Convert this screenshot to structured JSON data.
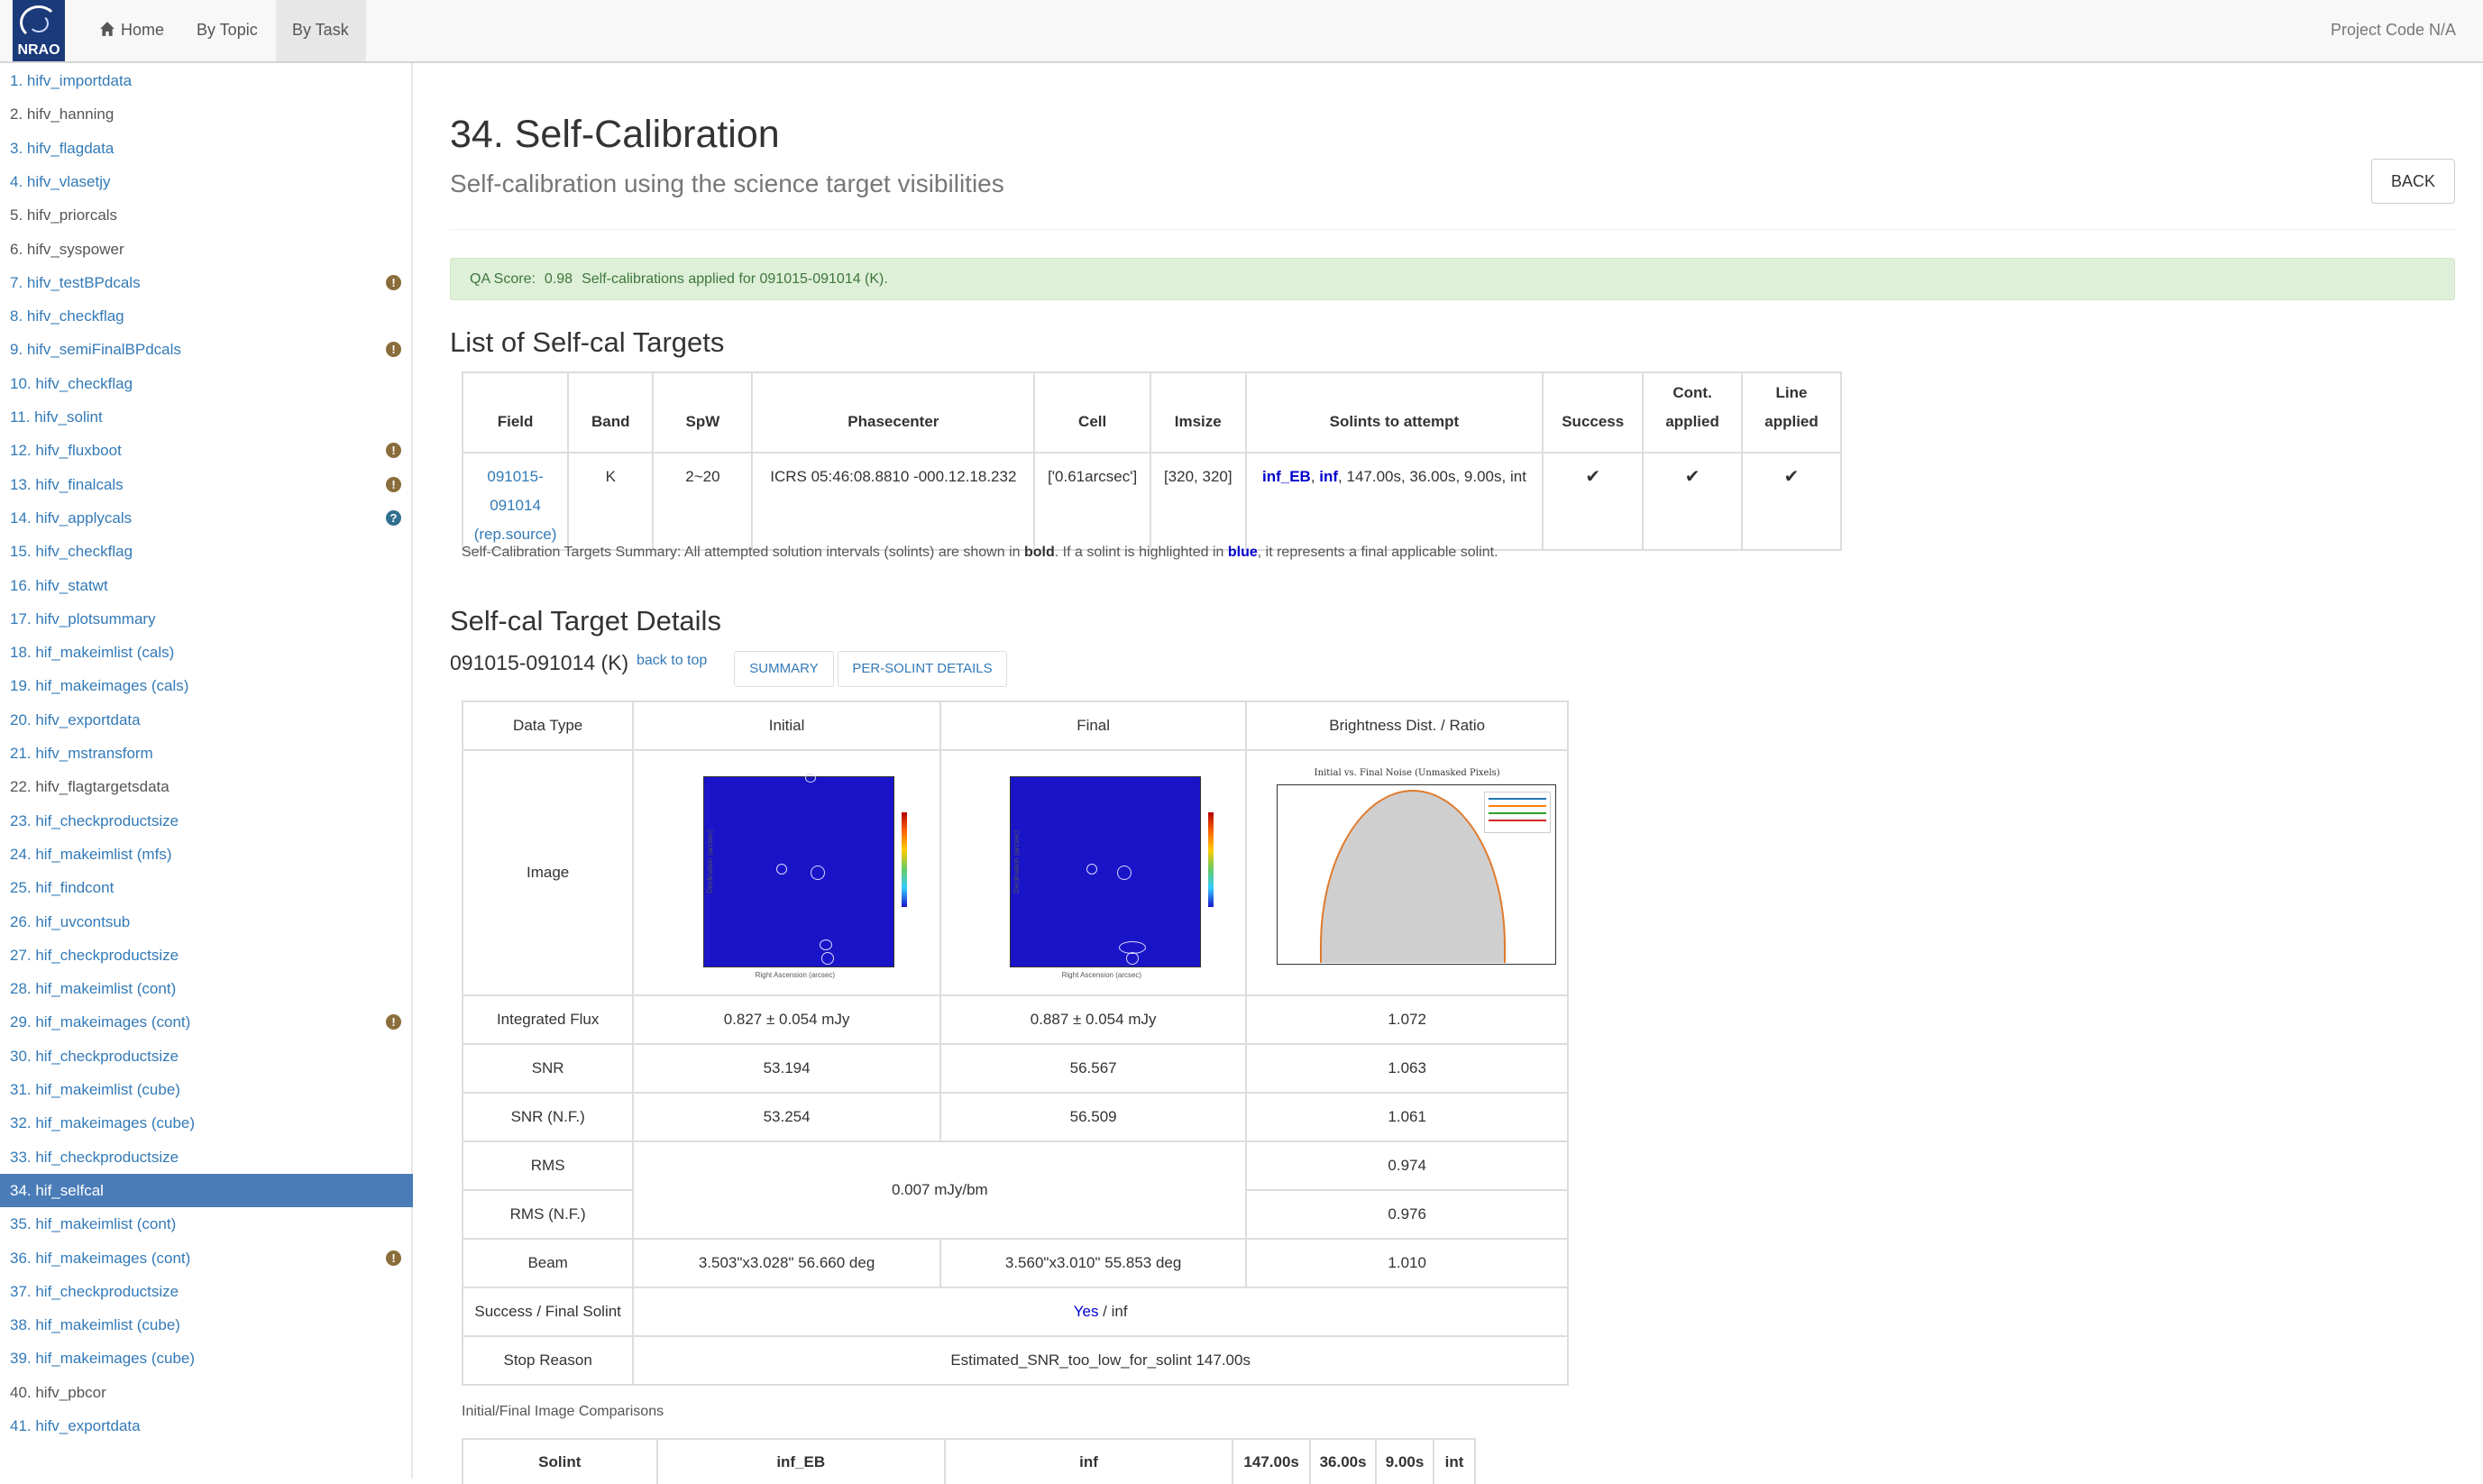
{
  "navbar": {
    "logo_text": "NRAO",
    "home_label": "Home",
    "topic_label": "By Topic",
    "task_label": "By Task",
    "project_code": "Project Code N/A"
  },
  "sidebar": {
    "items": [
      {
        "label": "1. hifv_importdata"
      },
      {
        "label": "2. hifv_hanning"
      },
      {
        "label": "3. hifv_flagdata"
      },
      {
        "label": "4. hifv_vlasetjy"
      },
      {
        "label": "5. hifv_priorcals"
      },
      {
        "label": "6. hifv_syspower"
      },
      {
        "label": "7. hifv_testBPdcals",
        "badge": "!"
      },
      {
        "label": "8. hifv_checkflag"
      },
      {
        "label": "9. hifv_semiFinalBPdcals",
        "badge": "!"
      },
      {
        "label": "10. hifv_checkflag"
      },
      {
        "label": "11. hifv_solint"
      },
      {
        "label": "12. hifv_fluxboot",
        "badge": "!"
      },
      {
        "label": "13. hifv_finalcals",
        "badge": "!"
      },
      {
        "label": "14. hifv_applycals",
        "badge": "?"
      },
      {
        "label": "15. hifv_checkflag"
      },
      {
        "label": "16. hifv_statwt"
      },
      {
        "label": "17. hifv_plotsummary"
      },
      {
        "label": "18. hif_makeimlist (cals)"
      },
      {
        "label": "19. hif_makeimages (cals)"
      },
      {
        "label": "20. hifv_exportdata"
      },
      {
        "label": "21. hifv_mstransform"
      },
      {
        "label": "22. hifv_flagtargetsdata"
      },
      {
        "label": "23. hif_checkproductsize"
      },
      {
        "label": "24. hif_makeimlist (mfs)"
      },
      {
        "label": "25. hif_findcont"
      },
      {
        "label": "26. hif_uvcontsub"
      },
      {
        "label": "27. hif_checkproductsize"
      },
      {
        "label": "28. hif_makeimlist (cont)"
      },
      {
        "label": "29. hif_makeimages (cont)",
        "badge": "!"
      },
      {
        "label": "30. hif_checkproductsize"
      },
      {
        "label": "31. hif_makeimlist (cube)"
      },
      {
        "label": "32. hif_makeimages (cube)"
      },
      {
        "label": "33. hif_checkproductsize"
      },
      {
        "label": "34. hif_selfcal"
      },
      {
        "label": "35. hif_makeimlist (cont)"
      },
      {
        "label": "36. hif_makeimages (cont)",
        "badge": "!"
      },
      {
        "label": "37. hif_checkproductsize"
      },
      {
        "label": "38. hif_makeimlist (cube)"
      },
      {
        "label": "39. hif_makeimages (cube)"
      },
      {
        "label": "40. hifv_pbcor"
      },
      {
        "label": "41. hifv_exportdata"
      }
    ],
    "grey_items": [
      1,
      4,
      5,
      21,
      39
    ],
    "active_index": 33
  },
  "main": {
    "title": "34. Self-Calibration",
    "subtitle": "Self-calibration using the science target visibilities",
    "back_label": "BACK",
    "qa": {
      "label": "QA Score:",
      "score": "0.98",
      "message": "Self-calibrations applied for 091015-091014 (K)."
    },
    "targets_heading": "List of Self-cal Targets",
    "targets_table": {
      "headers": [
        "Field",
        "Band",
        "SpW",
        "Phasecenter",
        "Cell",
        "Imsize",
        "Solints to attempt",
        "Success",
        "Cont. applied",
        "Line applied"
      ],
      "row": {
        "field": "091015-091014",
        "field_note": "(rep.source)",
        "band": "K",
        "spw": "2~20",
        "phasecenter": "ICRS 05:46:08.8810 -000.12.18.232",
        "cell": "['0.61arcsec']",
        "imsize": "[320, 320]",
        "solints_bold1": "inf_EB",
        "solints_bold2": "inf",
        "solints_rest": ", 147.00s, 36.00s, 9.00s, int",
        "success": "✔",
        "cont_applied": "✔",
        "line_applied": "✔"
      }
    },
    "targets_caption": {
      "part1": "Self-Calibration Targets Summary: All attempted solution intervals (solints) are shown in ",
      "bold": "bold",
      "part2": ". If a solint is highlighted in ",
      "blue": "blue",
      "part3": ", it represents a final applicable solint."
    },
    "details_heading": "Self-cal Target Details",
    "target_name": "091015-091014 (K)",
    "back_to_top": "back to top",
    "summary_btn": "SUMMARY",
    "persolint_btn": "PER-SOLINT DETAILS",
    "details_table": {
      "headers": [
        "Data Type",
        "Initial",
        "Final",
        "Brightness Dist. / Ratio"
      ],
      "image_label": "Image",
      "histogram_title": "Initial vs. Final Noise (Unmasked Pixels)",
      "skymap_ylabel": "Declination (arcsec)",
      "skymap_xlabel": "Right Ascension (arcsec)",
      "rows": [
        {
          "label": "Integrated Flux",
          "initial": "0.827 ± 0.054 mJy",
          "final": "0.887 ± 0.054 mJy",
          "ratio": "1.072"
        },
        {
          "label": "SNR",
          "initial": "53.194",
          "final": "56.567",
          "ratio": "1.063"
        },
        {
          "label": "SNR (N.F.)",
          "initial": "53.254",
          "final": "56.509",
          "ratio": "1.061"
        },
        {
          "label": "RMS",
          "ratio": "0.974"
        },
        {
          "label": "RMS (N.F.)",
          "ratio": "0.976"
        },
        {
          "label": "Beam",
          "initial": "3.503\"x3.028\" 56.660 deg",
          "final": "3.560\"x3.010\" 55.853 deg",
          "ratio": "1.010"
        }
      ],
      "rms_merged": "0.007 mJy/bm",
      "success_label": "Success / Final Solint",
      "success_yes": "Yes",
      "success_rest": " / inf",
      "stop_label": "Stop Reason",
      "stop_value": "Estimated_SNR_too_low_for_solint 147.00s"
    },
    "comparison_caption": "Initial/Final Image Comparisons",
    "solint_table": {
      "headers": [
        "Solint",
        "inf_EB",
        "inf",
        "147.00s",
        "36.00s",
        "9.00s",
        "int"
      ]
    }
  },
  "colors": {
    "accent": "#337ab7",
    "active_bg": "#4a7cb8",
    "qa_bg": "#dff0d8",
    "qa_text": "#3c763d",
    "warn_badge": "#8a6d3b",
    "info_badge": "#31708f"
  }
}
